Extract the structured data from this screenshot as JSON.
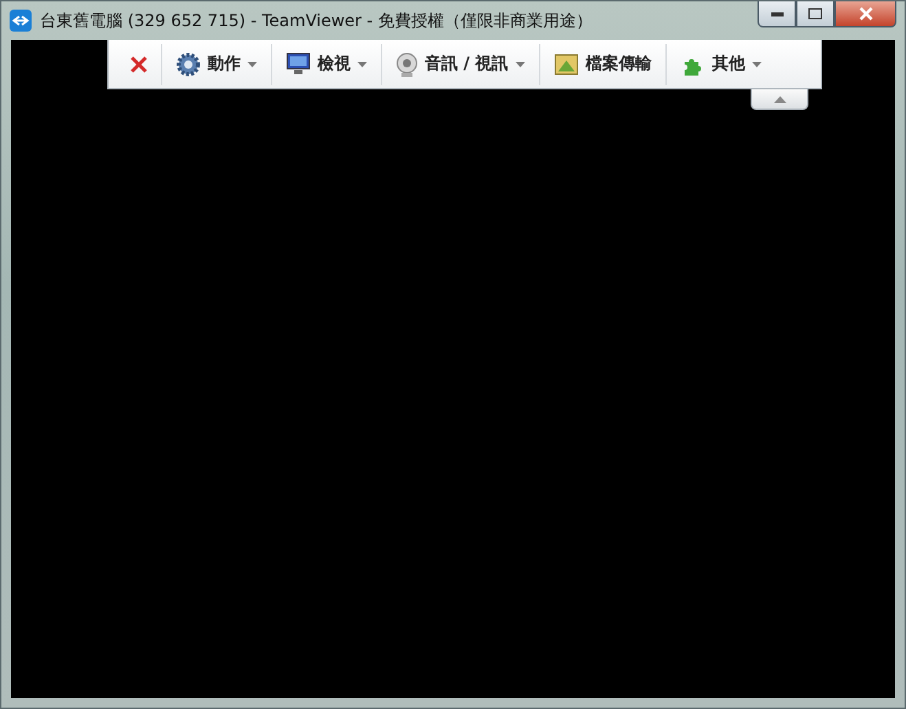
{
  "window": {
    "title": "台東舊電腦 (329 652 715) - TeamViewer - 免費授權（僅限非商業用途）"
  },
  "toolbar": {
    "items": [
      {
        "kind": "close"
      },
      {
        "kind": "menu",
        "label": "動作"
      },
      {
        "kind": "menu",
        "label": "檢視"
      },
      {
        "kind": "menu",
        "label": "音訊 / 視訊"
      },
      {
        "kind": "button",
        "label": "檔案傳輸"
      },
      {
        "kind": "menu",
        "label": "其他"
      }
    ]
  }
}
